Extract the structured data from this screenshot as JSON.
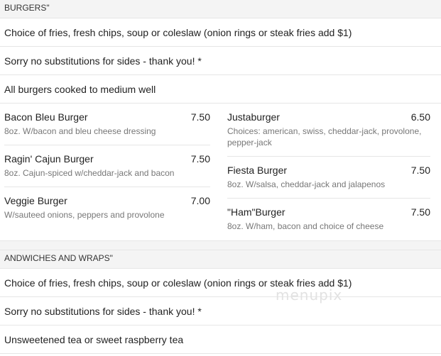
{
  "burgers": {
    "heading": "BURGERS\"",
    "notes": [
      "Choice of fries, fresh chips, soup or coleslaw (onion rings or steak fries add $1)",
      "Sorry no substitutions for sides - thank you! *",
      "All burgers cooked to medium well"
    ],
    "left_items": [
      {
        "name": "Bacon Bleu Burger",
        "price": "7.50",
        "desc": "8oz. W/bacon and bleu cheese dressing"
      },
      {
        "name": "Ragin' Cajun Burger",
        "price": "7.50",
        "desc": "8oz. Cajun-spiced w/cheddar-jack and bacon"
      },
      {
        "name": "Veggie Burger",
        "price": "7.00",
        "desc": "W/sauteed onions, peppers and provolone"
      }
    ],
    "right_items": [
      {
        "name": "Justaburger",
        "price": "6.50",
        "desc": "Choices: american, swiss, cheddar-jack, provolone, pepper-jack"
      },
      {
        "name": "Fiesta Burger",
        "price": "7.50",
        "desc": "8oz. W/salsa, cheddar-jack and jalapenos"
      },
      {
        "name": "\"Ham\"Burger",
        "price": "7.50",
        "desc": "8oz. W/ham, bacon and choice of cheese"
      }
    ]
  },
  "sandwiches": {
    "heading": "ANDWICHES AND WRAPS\"",
    "notes": [
      "Choice of fries, fresh chips, soup or coleslaw (onion rings or steak fries add $1)",
      "Sorry no substitutions for sides - thank you! *",
      "Unsweetened tea or sweet raspberry tea"
    ]
  },
  "watermark": "menupix"
}
